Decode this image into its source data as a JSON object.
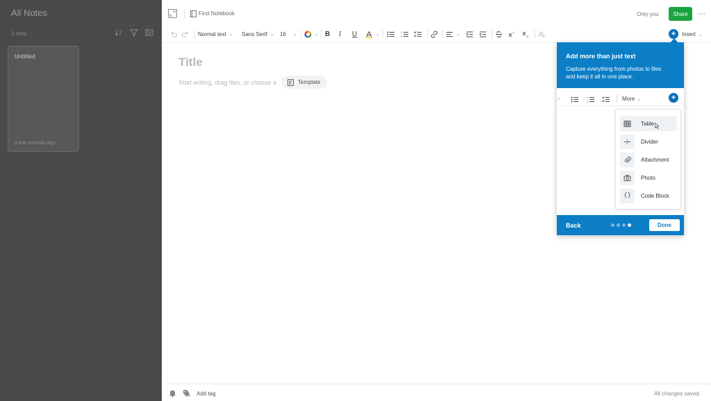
{
  "sidebar": {
    "title": "All Notes",
    "count": "1 note",
    "notes": [
      {
        "title": "Untitled",
        "time": "a few seconds ago"
      }
    ]
  },
  "header": {
    "notebook": "First Notebook",
    "sharing": "Only you",
    "share_label": "Share",
    "more": "···"
  },
  "toolbar": {
    "style_label": "Normal text",
    "font_label": "Sans Serif",
    "size_label": "16",
    "insert_label": "Insert",
    "accent": "#0b6fb8"
  },
  "editor": {
    "title_placeholder": "Title",
    "body_placeholder": "Start writing, drag files, or choose a",
    "template_label": "Template"
  },
  "popover": {
    "title": "Add more than just text",
    "description": "Capture everything from photos to files and keep it all in one place.",
    "more_label": "More",
    "menu": [
      {
        "label": "Table",
        "icon": "table-icon",
        "highlighted": true
      },
      {
        "label": "Divider",
        "icon": "divider-icon",
        "highlighted": false
      },
      {
        "label": "Attachment",
        "icon": "paperclip-icon",
        "highlighted": false
      },
      {
        "label": "Photo",
        "icon": "camera-icon",
        "highlighted": false
      },
      {
        "label": "Code Block",
        "icon": "code-icon",
        "highlighted": false
      }
    ],
    "back_label": "Back",
    "done_label": "Done",
    "step": 4,
    "steps_total": 4,
    "accent": "#0b7ec6"
  },
  "footer": {
    "add_tag": "Add tag",
    "status": "All changes saved."
  }
}
